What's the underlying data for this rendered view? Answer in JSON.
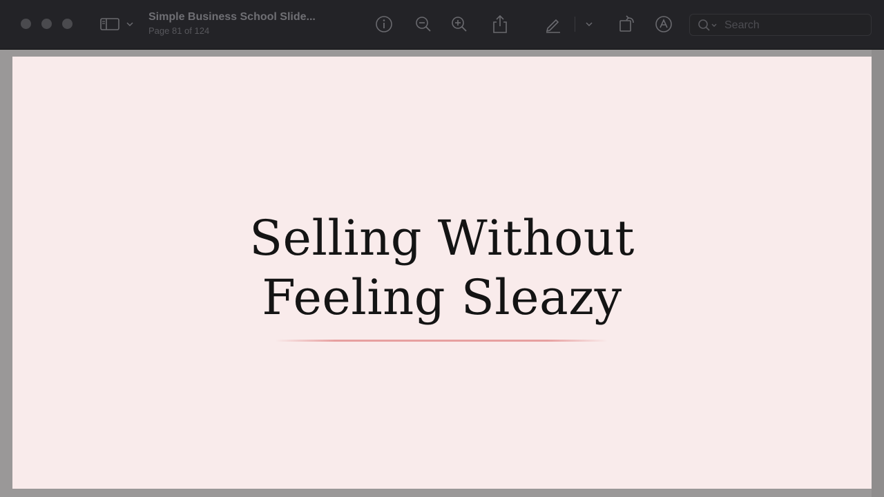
{
  "toolbar": {
    "document_title": "Simple Business School Slide...",
    "page_indicator": "Page 81 of 124",
    "search_placeholder": "Search",
    "icons": [
      "sidebar-toggle-icon",
      "chevron-down-icon",
      "info-icon",
      "zoom-out-icon",
      "zoom-in-icon",
      "share-icon",
      "markup-pen-icon",
      "rotate-icon",
      "annotate-icon",
      "search-icon"
    ]
  },
  "slide": {
    "title_line1": "Selling Without",
    "title_line2": "Feeling Sleazy",
    "background_color": "#f9ebeb",
    "accent_color": "#e7a0a0"
  }
}
